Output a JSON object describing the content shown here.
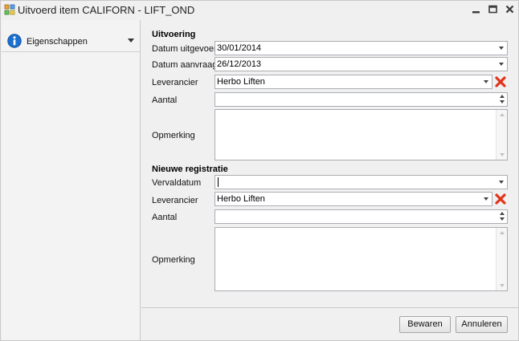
{
  "window": {
    "title": "Uitvoerd item CALIFORN - LIFT_OND"
  },
  "sidebar": {
    "header_label": "Eigenschappen",
    "icon": "info-icon"
  },
  "uitvoering": {
    "section_title": "Uitvoering",
    "datum_uitgevoerd_label": "Datum uitgevoerd",
    "datum_uitgevoerd_value": "30/01/2014",
    "datum_aanvraag_label": "Datum aanvraag",
    "datum_aanvraag_value": "26/12/2013",
    "leverancier_label": "Leverancier",
    "leverancier_value": "Herbo Liften",
    "aantal_label": "Aantal",
    "aantal_value": "",
    "opmerking_label": "Opmerking",
    "opmerking_value": ""
  },
  "nieuwe_registratie": {
    "section_title": "Nieuwe registratie",
    "vervaldatum_label": "Vervaldatum",
    "vervaldatum_value": "",
    "leverancier_label": "Leverancier",
    "leverancier_value": "Herbo Liften",
    "aantal_label": "Aantal",
    "aantal_value": "",
    "opmerking_label": "Opmerking",
    "opmerking_value": ""
  },
  "footer": {
    "save_label": "Bewaren",
    "cancel_label": "Annuleren"
  },
  "colors": {
    "info_icon": "#1a6fd0",
    "clear_icon": "#e0341a"
  }
}
